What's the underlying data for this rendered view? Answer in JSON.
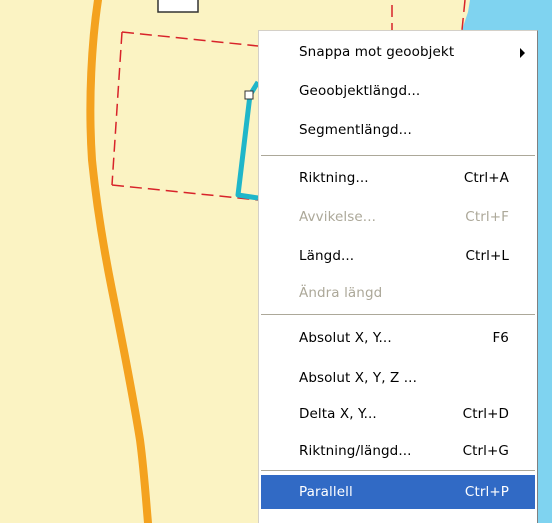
{
  "menu": {
    "items": [
      {
        "label": "Snappa mot geoobjekt",
        "shortcut": "",
        "submenu": true,
        "disabled": false,
        "selected": false
      },
      {
        "label": "Geoobjektlängd...",
        "shortcut": "",
        "submenu": false,
        "disabled": false,
        "selected": false
      },
      {
        "label": "Segmentlängd...",
        "shortcut": "",
        "submenu": false,
        "disabled": false,
        "selected": false
      },
      {
        "label": "Riktning...",
        "shortcut": "Ctrl+A",
        "submenu": false,
        "disabled": false,
        "selected": false
      },
      {
        "label": "Avvikelse...",
        "shortcut": "Ctrl+F",
        "submenu": false,
        "disabled": true,
        "selected": false
      },
      {
        "label": "Längd...",
        "shortcut": "Ctrl+L",
        "submenu": false,
        "disabled": false,
        "selected": false
      },
      {
        "label": "Ändra längd",
        "shortcut": "",
        "submenu": false,
        "disabled": true,
        "selected": false
      },
      {
        "label": "Absolut X, Y...",
        "shortcut": "F6",
        "submenu": false,
        "disabled": false,
        "selected": false
      },
      {
        "label": "Absolut X, Y, Z ...",
        "shortcut": "",
        "submenu": false,
        "disabled": false,
        "selected": false
      },
      {
        "label": "Delta X, Y...",
        "shortcut": "Ctrl+D",
        "submenu": false,
        "disabled": false,
        "selected": false
      },
      {
        "label": "Riktning/längd...",
        "shortcut": "Ctrl+G",
        "submenu": false,
        "disabled": false,
        "selected": false
      },
      {
        "label": "Parallell",
        "shortcut": "Ctrl+P",
        "submenu": false,
        "disabled": false,
        "selected": true
      }
    ]
  },
  "colors": {
    "map_background": "#fbf3c3",
    "road": "#f4a21f",
    "boundary_dashed": "#d8232a",
    "selected_line": "#1fb6c9",
    "water": "#7fd3f0",
    "highlight": "#316ac5",
    "disabled_text": "#aca899"
  }
}
